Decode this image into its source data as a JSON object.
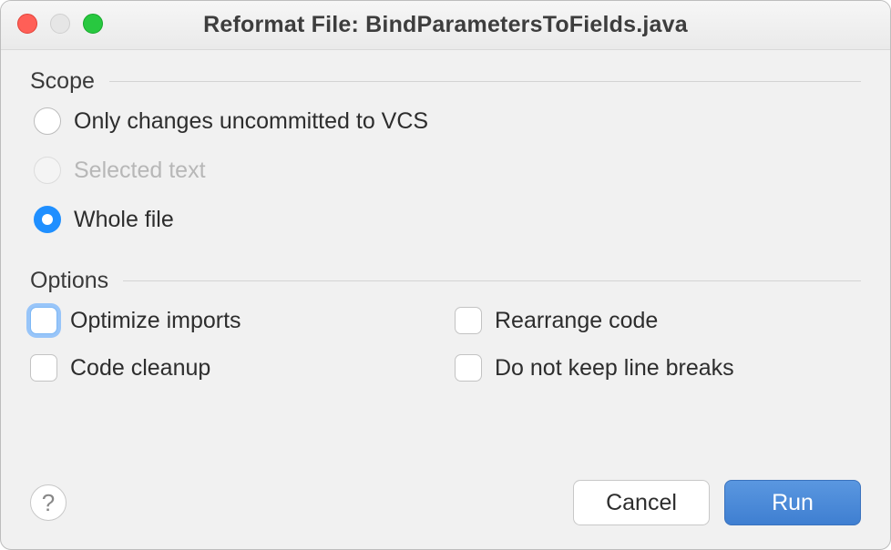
{
  "title": "Reformat File: BindParametersToFields.java",
  "scope": {
    "label": "Scope",
    "options": [
      {
        "label": "Only changes uncommitted to VCS",
        "state": "unselected"
      },
      {
        "label": "Selected text",
        "state": "disabled"
      },
      {
        "label": "Whole file",
        "state": "selected"
      }
    ]
  },
  "options": {
    "label": "Options",
    "items": [
      {
        "label": "Optimize imports",
        "checked": false,
        "focused": true
      },
      {
        "label": "Rearrange code",
        "checked": false,
        "focused": false
      },
      {
        "label": "Code cleanup",
        "checked": false,
        "focused": false
      },
      {
        "label": "Do not keep line breaks",
        "checked": false,
        "focused": false
      }
    ]
  },
  "buttons": {
    "cancel": "Cancel",
    "run": "Run"
  }
}
